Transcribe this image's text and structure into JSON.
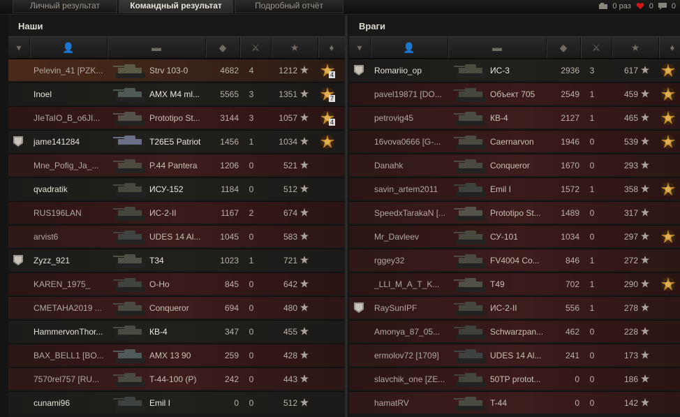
{
  "tabs": [
    {
      "label": "Личный результат",
      "active": false
    },
    {
      "label": "Командный результат",
      "active": true
    },
    {
      "label": "Подробный отчёт",
      "active": false
    }
  ],
  "counters": {
    "replays": "0 раз",
    "likes": "0",
    "messages": "0"
  },
  "teams": [
    {
      "title": "Наши",
      "rows": [
        {
          "rank": false,
          "name": "Pelevin_41 [PZK...",
          "vehicle": "Strv 103-0",
          "damage": "4682",
          "kills": "4",
          "xp": "1212",
          "medal": true,
          "medal_count": "4",
          "style": "me",
          "alive": false,
          "tank_color": "#5a5a44"
        },
        {
          "rank": false,
          "name": "Inoel",
          "vehicle": "AMX M4 ml...",
          "damage": "5565",
          "kills": "3",
          "xp": "1351",
          "medal": true,
          "medal_count": "7",
          "style": "dark",
          "alive": true,
          "tank_color": "#4f5a54"
        },
        {
          "rank": false,
          "name": "JIeTaIO_B_o6JI...",
          "vehicle": "Prototipo St...",
          "damage": "3144",
          "kills": "3",
          "xp": "1057",
          "medal": true,
          "medal_count": "4",
          "style": "red",
          "alive": false,
          "tank_color": "#55524a"
        },
        {
          "rank": true,
          "name": "jame141284",
          "vehicle": "T26E5 Patriot",
          "damage": "1456",
          "kills": "1",
          "xp": "1034",
          "medal": true,
          "medal_count": "",
          "style": "dark",
          "alive": true,
          "tank_color": "#6a6e86"
        },
        {
          "rank": false,
          "name": "Mne_Pofig_Ja_...",
          "vehicle": "P.44 Pantera",
          "damage": "1206",
          "kills": "0",
          "xp": "521",
          "medal": false,
          "medal_count": "",
          "style": "red2",
          "alive": false,
          "tank_color": "#4f4a3e"
        },
        {
          "rank": false,
          "name": "qvadratik",
          "vehicle": "ИСУ-152",
          "damage": "1184",
          "kills": "0",
          "xp": "512",
          "medal": false,
          "medal_count": "",
          "style": "dark",
          "alive": true,
          "tank_color": "#48493e"
        },
        {
          "rank": false,
          "name": "RUS196LAN",
          "vehicle": "ИС-2-II",
          "damage": "1167",
          "kills": "2",
          "xp": "674",
          "medal": false,
          "medal_count": "",
          "style": "red",
          "alive": false,
          "tank_color": "#45463c"
        },
        {
          "rank": false,
          "name": "arvist6",
          "vehicle": "UDES 14 Al...",
          "damage": "1045",
          "kills": "0",
          "xp": "583",
          "medal": false,
          "medal_count": "",
          "style": "red2",
          "alive": false,
          "tank_color": "#3e4240"
        },
        {
          "rank": true,
          "name": "Zyzz_921",
          "vehicle": "T34",
          "damage": "1023",
          "kills": "1",
          "xp": "721",
          "medal": false,
          "medal_count": "",
          "style": "dark",
          "alive": true,
          "tank_color": "#505046"
        },
        {
          "rank": false,
          "name": "KAREN_1975_",
          "vehicle": "O-Ho",
          "damage": "845",
          "kills": "0",
          "xp": "642",
          "medal": false,
          "medal_count": "",
          "style": "red",
          "alive": false,
          "tank_color": "#3f443e"
        },
        {
          "rank": false,
          "name": "CMETAHA2019 ...",
          "vehicle": "Conqueror",
          "damage": "694",
          "kills": "0",
          "xp": "480",
          "medal": false,
          "medal_count": "",
          "style": "red2",
          "alive": false,
          "tank_color": "#4a4a40"
        },
        {
          "rank": false,
          "name": "HammervonThor...",
          "vehicle": "КВ-4",
          "damage": "347",
          "kills": "0",
          "xp": "455",
          "medal": false,
          "medal_count": "",
          "style": "dark",
          "alive": true,
          "tank_color": "#4a4b42"
        },
        {
          "rank": false,
          "name": "BAX_BELL1 [BO...",
          "vehicle": "AMX 13 90",
          "damage": "259",
          "kills": "0",
          "xp": "428",
          "medal": false,
          "medal_count": "",
          "style": "red",
          "alive": false,
          "tank_color": "#505a5a"
        },
        {
          "rank": false,
          "name": "7570rel757 [RU...",
          "vehicle": "T-44-100 (P)",
          "damage": "242",
          "kills": "0",
          "xp": "443",
          "medal": false,
          "medal_count": "",
          "style": "red2",
          "alive": false,
          "tank_color": "#4a4a40"
        },
        {
          "rank": false,
          "name": "cunami96",
          "vehicle": "Emil I",
          "damage": "0",
          "kills": "0",
          "xp": "512",
          "medal": false,
          "medal_count": "",
          "style": "dark",
          "alive": true,
          "tank_color": "#3e423e"
        }
      ]
    },
    {
      "title": "Враги",
      "rows": [
        {
          "rank": true,
          "name": "Romariio_op",
          "vehicle": "ИС-3",
          "damage": "2936",
          "kills": "3",
          "xp": "617",
          "medal": true,
          "medal_count": "",
          "style": "dark",
          "alive": true,
          "tank_color": "#4a4c40"
        },
        {
          "rank": false,
          "name": "pavel19871 [DO...",
          "vehicle": "Объект 705",
          "damage": "2549",
          "kills": "1",
          "xp": "459",
          "medal": true,
          "medal_count": "",
          "style": "red",
          "alive": false,
          "tank_color": "#45473e"
        },
        {
          "rank": false,
          "name": "petrovig45",
          "vehicle": "КВ-4",
          "damage": "2127",
          "kills": "1",
          "xp": "465",
          "medal": true,
          "medal_count": "",
          "style": "red2",
          "alive": false,
          "tank_color": "#4a4b42"
        },
        {
          "rank": false,
          "name": "16vova0666 [G-...",
          "vehicle": "Caernarvon",
          "damage": "1946",
          "kills": "0",
          "xp": "539",
          "medal": true,
          "medal_count": "",
          "style": "red",
          "alive": false,
          "tank_color": "#4a4a40"
        },
        {
          "rank": false,
          "name": "Danahk",
          "vehicle": "Conqueror",
          "damage": "1670",
          "kills": "0",
          "xp": "293",
          "medal": false,
          "medal_count": "",
          "style": "red2",
          "alive": false,
          "tank_color": "#4a4a40"
        },
        {
          "rank": false,
          "name": "savin_artem2011",
          "vehicle": "Emil I",
          "damage": "1572",
          "kills": "1",
          "xp": "358",
          "medal": true,
          "medal_count": "",
          "style": "red",
          "alive": false,
          "tank_color": "#3e423e"
        },
        {
          "rank": false,
          "name": "SpeedxTarakaN [...",
          "vehicle": "Prototipo St...",
          "damage": "1489",
          "kills": "0",
          "xp": "317",
          "medal": false,
          "medal_count": "",
          "style": "red2",
          "alive": false,
          "tank_color": "#55524a"
        },
        {
          "rank": false,
          "name": "Mr_Davleev",
          "vehicle": "СУ-101",
          "damage": "1034",
          "kills": "0",
          "xp": "297",
          "medal": true,
          "medal_count": "",
          "style": "red",
          "alive": false,
          "tank_color": "#484a3e"
        },
        {
          "rank": false,
          "name": "rggey32",
          "vehicle": "FV4004 Co...",
          "damage": "846",
          "kills": "1",
          "xp": "272",
          "medal": false,
          "medal_count": "",
          "style": "red2",
          "alive": false,
          "tank_color": "#4a4a40"
        },
        {
          "rank": false,
          "name": "_LLI_M_A_T_K...",
          "vehicle": "T49",
          "damage": "702",
          "kills": "1",
          "xp": "290",
          "medal": true,
          "medal_count": "",
          "style": "red",
          "alive": false,
          "tank_color": "#505046"
        },
        {
          "rank": true,
          "name": "RaySunIPF",
          "vehicle": "ИС-2-II",
          "damage": "556",
          "kills": "1",
          "xp": "278",
          "medal": false,
          "medal_count": "",
          "style": "red2",
          "alive": false,
          "tank_color": "#45463c"
        },
        {
          "rank": false,
          "name": "Amonya_87_05...",
          "vehicle": "Schwarzpan...",
          "damage": "462",
          "kills": "0",
          "xp": "228",
          "medal": false,
          "medal_count": "",
          "style": "red",
          "alive": false,
          "tank_color": "#3e403c"
        },
        {
          "rank": false,
          "name": "ermolov72 [1709]",
          "vehicle": "UDES 14 Al...",
          "damage": "241",
          "kills": "0",
          "xp": "173",
          "medal": false,
          "medal_count": "",
          "style": "red2",
          "alive": false,
          "tank_color": "#3e4240"
        },
        {
          "rank": false,
          "name": "slavchik_one [ZE...",
          "vehicle": "50TP protot...",
          "damage": "0",
          "kills": "0",
          "xp": "186",
          "medal": false,
          "medal_count": "",
          "style": "red",
          "alive": false,
          "tank_color": "#44463e"
        },
        {
          "rank": false,
          "name": "hamatRV",
          "vehicle": "T-44",
          "damage": "0",
          "kills": "0",
          "xp": "142",
          "medal": false,
          "medal_count": "",
          "style": "red2",
          "alive": false,
          "tank_color": "#4a4a40"
        }
      ]
    }
  ],
  "icons": {
    "header_cols": [
      "rank-icon",
      "player-icon",
      "vehicle-icon",
      "damage-icon",
      "kills-icon",
      "xp-star-icon",
      "medal-icon"
    ],
    "accent_medal": "#c08a2c",
    "red_row": "#3a1a1a"
  }
}
